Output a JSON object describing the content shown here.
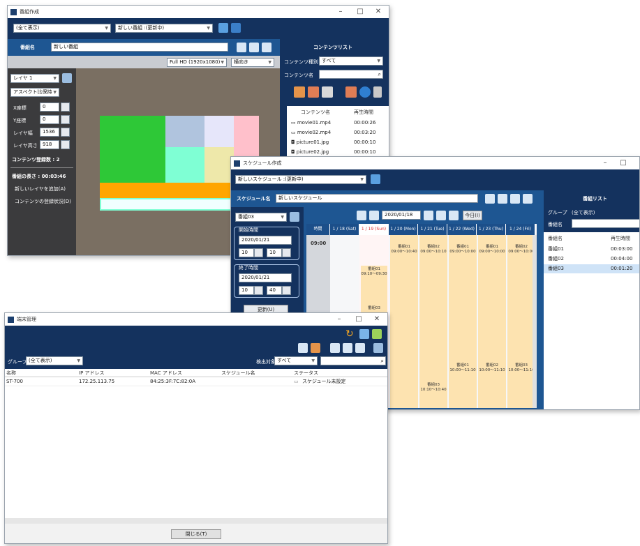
{
  "program_window": {
    "title": "番組作成",
    "group_select": "(全て表示)",
    "program_select": "新しい番組 :(更新中)",
    "name_label": "番組名",
    "name_value": "新しい番組",
    "resolution": "Full HD (1920x1080)",
    "orientation": "横向き",
    "layer_select": "レイヤ 1",
    "aspect_select": "アスペクト比保持",
    "fields": [
      {
        "label": "X座標",
        "value": "0"
      },
      {
        "label": "Y座標",
        "value": "0"
      },
      {
        "label": "レイヤ幅",
        "value": "1536"
      },
      {
        "label": "レイヤ高さ",
        "value": "918"
      }
    ],
    "content_count": "コンテンツ登録数 : 2",
    "length": "番組の長さ : 00:03:46",
    "add_layer": "新しいレイヤを追加(A)",
    "content_status": "コンテンツの登録状況(D)",
    "content_list": {
      "title": "コンテンツリスト",
      "type_label": "コンテンツ種別",
      "type_value": "すべて",
      "name_label": "コンテンツ名",
      "col_name": "コンテンツ名",
      "col_time": "再生時間",
      "items": [
        {
          "name": "movie01.mp4",
          "time": "00:00:26"
        },
        {
          "name": "movie02.mp4",
          "time": "00:03:20"
        },
        {
          "name": "picture01.jpg",
          "time": "00:00:10"
        },
        {
          "name": "picture02.jpg",
          "time": "00:00:10"
        }
      ]
    }
  },
  "schedule_window": {
    "title": "スケジュール作成",
    "schedule_select": "新しいスケジュール :(更新中)",
    "name_label": "スケジュール名",
    "name_value": "新しいスケジュール",
    "program_select": "番組03",
    "start_label": "開始時間",
    "start_date": "2020/01/21",
    "start_h": "10",
    "start_m": "10",
    "end_label": "終了時間",
    "end_date": "2020/01/21",
    "end_h": "10",
    "end_m": "40",
    "update_btn": "更新(U)",
    "date_field": "2020/01/18",
    "today_btn": "今日(I)",
    "time_col": "時間",
    "time_row": "09:00",
    "days": [
      "1 / 18 (Sat)",
      "1 / 19 (Sun)",
      "1 / 20 (Mon)",
      "1 / 21 (Tue)",
      "1 / 22 (Wed)",
      "1 / 23 (Thu)",
      "1 / 24 (Fri)"
    ],
    "events_top": [
      {
        "name": "番組01",
        "time": "09:00〜10:40"
      },
      {
        "name": "番組02",
        "time": "09:00〜10:10"
      },
      {
        "name": "番組01",
        "time": "09:00〜10:00"
      },
      {
        "name": "番組01",
        "time": "09:00〜10:00"
      },
      {
        "name": "番組02",
        "time": "09:00〜10:00"
      }
    ],
    "event_mid": {
      "name": "番組01",
      "time": "09:10〜09:30"
    },
    "event_mid2": {
      "name": "番組03"
    },
    "events_bot": [
      {
        "name": "番組01",
        "time": "10:00〜11:10"
      },
      {
        "name": "番組02",
        "time": "10:00〜11:10"
      },
      {
        "name": "番組03",
        "time": "10:00〜11:10"
      }
    ],
    "event_bot2": {
      "name": "番組03",
      "time": "10:10〜10:40"
    },
    "program_list": {
      "title": "番組リスト",
      "group_label": "グループ",
      "group_value": "(全て表示)",
      "name_label": "番組名",
      "col_name": "番組名",
      "col_time": "再生時間",
      "items": [
        {
          "name": "番組01",
          "time": "00:03:00"
        },
        {
          "name": "番組02",
          "time": "00:04:00"
        },
        {
          "name": "番組03",
          "time": "00:01:20"
        }
      ]
    }
  },
  "terminal_window": {
    "title": "端末管理",
    "group_label": "グループ",
    "group_value": "(全て表示)",
    "target_label": "検出対象",
    "target_value": "すべて",
    "columns": [
      "名称",
      "IP アドレス",
      "MAC アドレス",
      "スケジュール名",
      "ステータス"
    ],
    "row": [
      "ST-700",
      "172.25.113.75",
      "84:25:3F:7C:82:0A",
      "",
      "スケジュール未設定"
    ],
    "close_btn": "閉じる(T)"
  },
  "colors": {
    "navy": "#14325e",
    "blue": "#1e5692",
    "accent_orange": "#ffa500",
    "event_fill": "#fde3b0"
  }
}
